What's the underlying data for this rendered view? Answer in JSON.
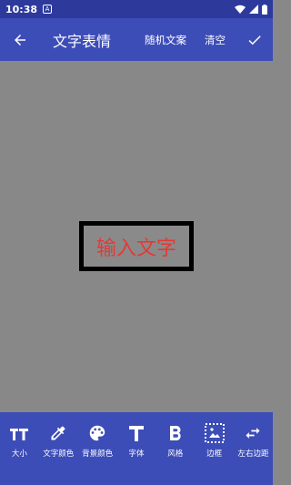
{
  "status": {
    "time": "10:38",
    "notify_letter": "A"
  },
  "app_bar": {
    "title": "文字表情",
    "random_label": "随机文案",
    "clear_label": "清空"
  },
  "canvas": {
    "placeholder_text": "输入文字",
    "text_color": "#e53935",
    "bg_color": "#888888"
  },
  "colors": {
    "primary": "#3d4db7",
    "status": "#2d3a9c"
  },
  "toolbar": [
    {
      "label": "大小",
      "icon": "text-size-icon"
    },
    {
      "label": "文字颜色",
      "icon": "eyedropper-icon"
    },
    {
      "label": "背景颜色",
      "icon": "palette-icon"
    },
    {
      "label": "字体",
      "icon": "font-t-icon"
    },
    {
      "label": "风格",
      "icon": "bold-icon"
    },
    {
      "label": "边框",
      "icon": "border-image-icon"
    },
    {
      "label": "左右边距",
      "icon": "swap-horizontal-icon"
    }
  ]
}
